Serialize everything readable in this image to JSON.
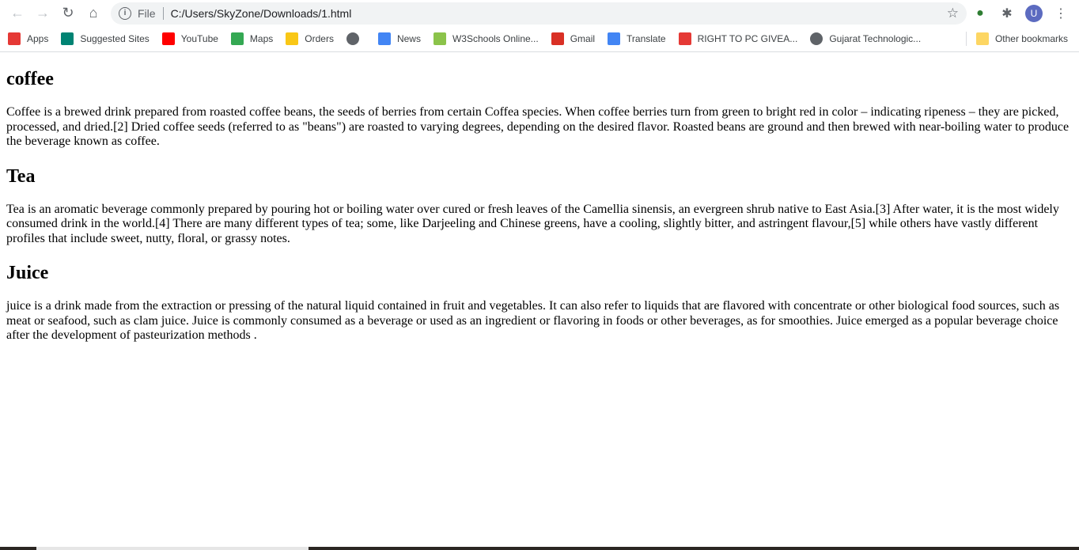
{
  "browser": {
    "address_prefix": "File",
    "url": "C:/Users/SkyZone/Downloads/1.html",
    "avatar_letter": "U",
    "bookmarks": [
      {
        "label": "Apps",
        "icon": "apps-grid-icon",
        "color": "#e53935"
      },
      {
        "label": "Suggested Sites",
        "icon": "bing-icon",
        "color": "#008373"
      },
      {
        "label": "YouTube",
        "icon": "youtube-icon",
        "color": "#ff0000"
      },
      {
        "label": "Maps",
        "icon": "maps-pin-icon",
        "color": "#34a853"
      },
      {
        "label": "Orders",
        "icon": "flipkart-icon",
        "color": "#f9c716"
      },
      {
        "label": "",
        "icon": "globe-icon",
        "color": "#5f6368"
      },
      {
        "label": "News",
        "icon": "google-news-icon",
        "color": "#4285f4"
      },
      {
        "label": "W3Schools Online...",
        "icon": "w3schools-icon",
        "color": "#8bc34a"
      },
      {
        "label": "Gmail",
        "icon": "gmail-icon",
        "color": "#d93025"
      },
      {
        "label": "Translate",
        "icon": "translate-icon",
        "color": "#4285f4"
      },
      {
        "label": "RIGHT TO PC GIVEA...",
        "icon": "shield-icon",
        "color": "#e53935"
      },
      {
        "label": "Gujarat Technologic...",
        "icon": "globe-icon",
        "color": "#5f6368"
      }
    ],
    "other_bookmarks": "Other bookmarks"
  },
  "page": {
    "sections": [
      {
        "heading": "coffee",
        "text": "Coffee is a brewed drink prepared from roasted coffee beans, the seeds of berries from certain Coffea species. When coffee berries turn from green to bright red in color – indicating ripeness – they are picked, processed, and dried.[2] Dried coffee seeds (referred to as \"beans\") are roasted to varying degrees, depending on the desired flavor. Roasted beans are ground and then brewed with near-boiling water to produce the beverage known as coffee."
      },
      {
        "heading": "Tea",
        "text": "Tea is an aromatic beverage commonly prepared by pouring hot or boiling water over cured or fresh leaves of the Camellia sinensis, an evergreen shrub native to East Asia.[3] After water, it is the most widely consumed drink in the world.[4] There are many different types of tea; some, like Darjeeling and Chinese greens, have a cooling, slightly bitter, and astringent flavour,[5] while others have vastly different profiles that include sweet, nutty, floral, or grassy notes."
      },
      {
        "heading": "Juice",
        "text": "juice is a drink made from the extraction or pressing of the natural liquid contained in fruit and vegetables. It can also refer to liquids that are flavored with concentrate or other biological food sources, such as meat or seafood, such as clam juice. Juice is commonly consumed as a beverage or used as an ingredient or flavoring in foods or other beverages, as for smoothies. Juice emerged as a popular beverage choice after the development of pasteurization methods ."
      }
    ]
  }
}
